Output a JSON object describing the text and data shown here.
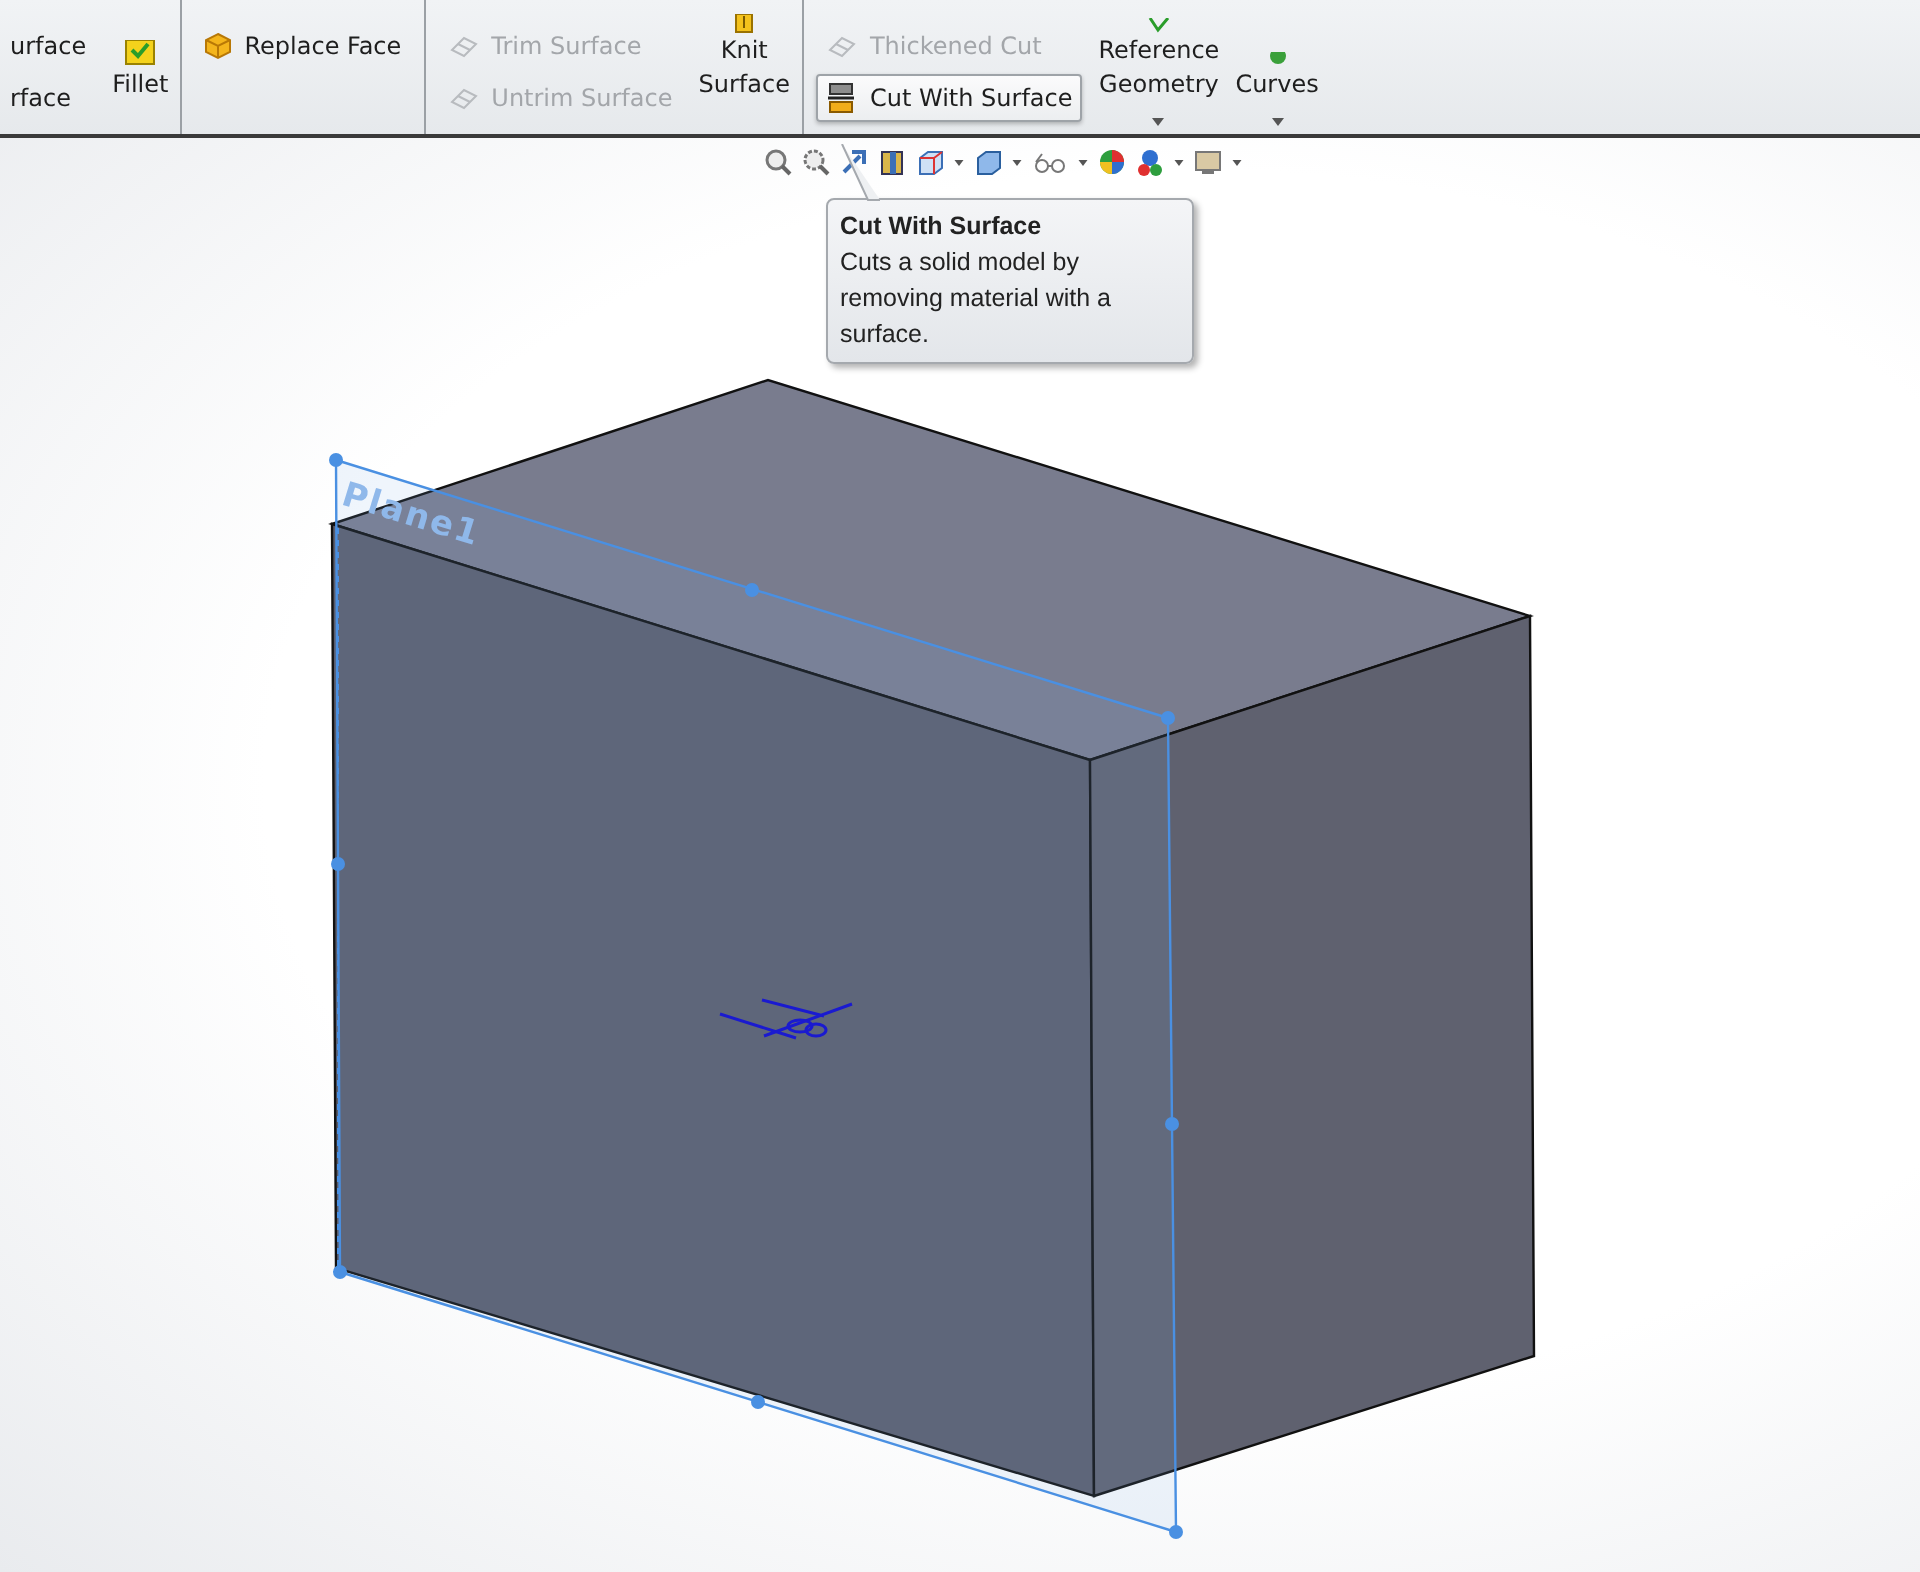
{
  "toolbar": {
    "groups": [
      {
        "kind": "list",
        "items": [
          {
            "label": "urface",
            "disabled": false,
            "highlighted": false
          },
          {
            "label": "rface",
            "disabled": false,
            "highlighted": false
          }
        ]
      },
      {
        "kind": "large",
        "label_lines": [
          "Fillet"
        ],
        "dropdown": false
      },
      {
        "kind": "divider"
      },
      {
        "kind": "list",
        "items": [
          {
            "label": "Replace Face",
            "disabled": false,
            "highlighted": false
          }
        ]
      },
      {
        "kind": "divider"
      },
      {
        "kind": "list",
        "items": [
          {
            "label": "Trim Surface",
            "disabled": true,
            "highlighted": false
          },
          {
            "label": "Untrim Surface",
            "disabled": true,
            "highlighted": false
          }
        ]
      },
      {
        "kind": "large",
        "label_lines": [
          "Knit",
          "Surface"
        ],
        "dropdown": false
      },
      {
        "kind": "divider"
      },
      {
        "kind": "list",
        "items": [
          {
            "label": "Thickened Cut",
            "disabled": true,
            "highlighted": false
          },
          {
            "label": "Cut With Surface",
            "disabled": false,
            "highlighted": true
          }
        ]
      },
      {
        "kind": "large",
        "label_lines": [
          "Reference",
          "Geometry"
        ],
        "dropdown": true
      },
      {
        "kind": "large",
        "label_lines": [
          "Curves"
        ],
        "dropdown": true
      }
    ]
  },
  "tooltip": {
    "title": "Cut With Surface",
    "description": "Cuts a solid model by removing material with a surface."
  },
  "viewport": {
    "plane_label": "Plane1"
  }
}
